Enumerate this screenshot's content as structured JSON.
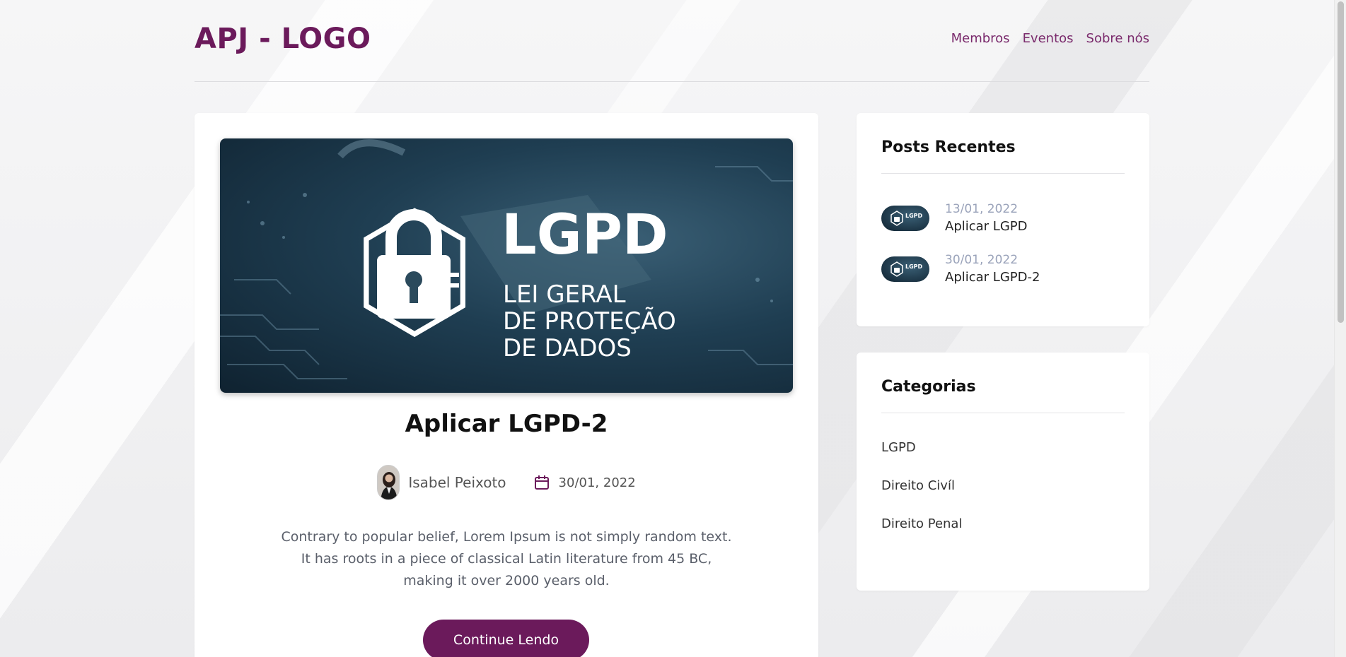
{
  "brand": {
    "logo_text": "APJ - LOGO",
    "accent": "#6b1a5b"
  },
  "nav": {
    "items": [
      {
        "label": "Membros"
      },
      {
        "label": "Eventos"
      },
      {
        "label": "Sobre nós"
      }
    ]
  },
  "post": {
    "image_text": {
      "headline": "LGPD",
      "line1": "LEI GERAL",
      "line2": "DE PROTEÇÃO",
      "line3": "DE DADOS"
    },
    "title": "Aplicar LGPD-2",
    "author": "Isabel Peixoto",
    "date": "30/01, 2022",
    "excerpt": "Contrary to popular belief, Lorem Ipsum is not simply random text. It has roots in a piece of classical Latin literature from 45 BC, making it over 2000 years old.",
    "continue_label": "Continue Lendo"
  },
  "recent_posts": {
    "title": "Posts Recentes",
    "items": [
      {
        "date": "13/01, 2022",
        "title": "Aplicar LGPD",
        "thumb_text": "LGPD"
      },
      {
        "date": "30/01, 2022",
        "title": "Aplicar LGPD-2",
        "thumb_text": "LGPD"
      }
    ]
  },
  "categories": {
    "title": "Categorias",
    "items": [
      {
        "label": "LGPD"
      },
      {
        "label": "Direito Civíl"
      },
      {
        "label": "Direito Penal"
      }
    ]
  }
}
